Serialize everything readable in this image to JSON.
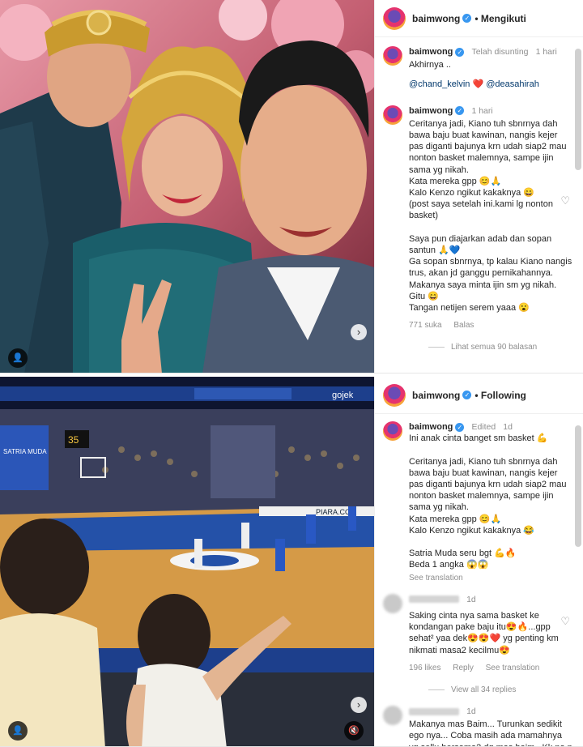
{
  "post1": {
    "username": "baimwong",
    "follow_label": "Mengikuti",
    "comments": [
      {
        "username": "baimwong",
        "meta_edited": "Telah disunting",
        "meta_time": "1 hari",
        "text_line1": "Akhirnya ..",
        "mention1": "@chand_kelvin",
        "heart": "❤️",
        "mention2": "@deasahirah"
      },
      {
        "username": "baimwong",
        "meta_time": "1 hari",
        "text": "Ceritanya jadi, Kiano tuh sbnrnya dah bawa baju buat kawinan, nangis kejer pas diganti bajunya krn udah siap2 mau nonton basket malemnya, sampe ijin sama yg nikah.\nKata mereka gpp 😊🙏\nKalo Kenzo ngikut kakaknya 😄\n(post saya setelah ini.kami lg nonton basket)\n\nSaya pun diajarkan adab dan sopan santun 🙏💙\nGa sopan sbnrnya, tp kalau Kiano nangis trus, akan jd ganggu pernikahannya. Makanya saya minta ijin sm yg nikah. Gitu 😄\nTangan netijen serem yaaa 😮",
        "likes": "771 suka",
        "reply_label": "Balas",
        "view_replies": "Lihat semua 90 balasan"
      }
    ]
  },
  "post2": {
    "username": "baimwong",
    "follow_label": "Following",
    "caption": {
      "username": "baimwong",
      "meta_edited": "Edited",
      "meta_time": "1d",
      "text": "Ini anak cinta banget sm basket 💪\n\nCeritanya jadi, Kiano tuh sbnrnya dah bawa baju buat kawinan, nangis kejer pas diganti bajunya krn udah siap2 mau nonton basket malemnya, sampe ijin sama yg nikah.\nKata mereka gpp 😊🙏\nKalo Kenzo ngikut kakaknya 😂\n\nSatria Muda seru bgt 💪🔥\nBeda 1 angka 😱😱",
      "see_translation": "See translation"
    },
    "comments": [
      {
        "meta_time": "1d",
        "text": "Saking cinta nya sama basket ke kondangan pake baju itu😍🔥...gpp sehat² yaa dek😍😍❤️ yg penting km nikmati masa2 kecilmu😍",
        "likes": "196 likes",
        "reply_label": "Reply",
        "see_translation": "See translation",
        "view_replies": "View all 34 replies"
      },
      {
        "meta_time": "1d",
        "text": "Makanya mas Baim... Turunkan sedikit ego nya... Coba masih ada mamahnya yg sellu bersama2 dg mas baim.. Kk no n dd Ho pastinya"
      }
    ],
    "scoreboard": "35",
    "court_ad": "PIARA.COM",
    "banner_left": "SATRIA MUDA",
    "arena_sign": "gojek"
  },
  "colors": {
    "verified": "#3897f0",
    "mention": "#00376b",
    "meta": "#8e8e8e"
  }
}
